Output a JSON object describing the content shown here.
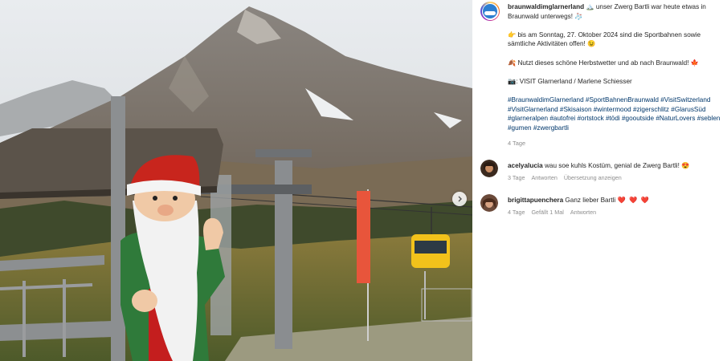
{
  "post": {
    "username": "braunwaldimglarnerland",
    "caption_line1": " 🏔️ unser Zwerg Bartli war heute etwas in Braunwald unterwegs! 🧦",
    "caption_line2": "👉 bis am Sonntag, 27. Oktober 2024 sind die Sportbahnen sowie sämtliche Aktivitäten offen! 😉",
    "caption_line3": "🍂 Nutzt dieses schöne Herbstwetter und ab nach Braunwald! 🍁",
    "caption_line4": "📷: VISIT Glarnerland / Marlene Schiesser",
    "hashtags": "#BraunwaldimGlarnerland #SportBahnenBraunwald #VisitSwitzerland #VisitGlarnerland #Skisaison #wintermood #zigerschlitz #GlarusSüd #glarneralpen #autofrei #ortstock #tödi #gooutside #NaturLovers #seblen #gumen #zwergbartli",
    "time": "4 Tage"
  },
  "comments": [
    {
      "username": "acelyalucia",
      "text": " wau soe kuhls Kostüm, genial de Zwerg Bartli! 😍",
      "time": "3 Tage",
      "reply": "Antworten",
      "translate": "Übersetzung anzeigen"
    },
    {
      "username": "brigittapuenchera",
      "text": " Ganz lieber Bartli ",
      "hearts": "❤️ ❤️ ❤️",
      "time": "4 Tage",
      "likes": "Gefällt 1 Mal",
      "reply": "Antworten"
    }
  ],
  "icons": {
    "next": "chevron-right-icon",
    "profile": "braunwald-logo-icon"
  },
  "colors": {
    "hashtag": "#00376b",
    "muted": "#8e8e8e",
    "heart": "#ed4956"
  }
}
